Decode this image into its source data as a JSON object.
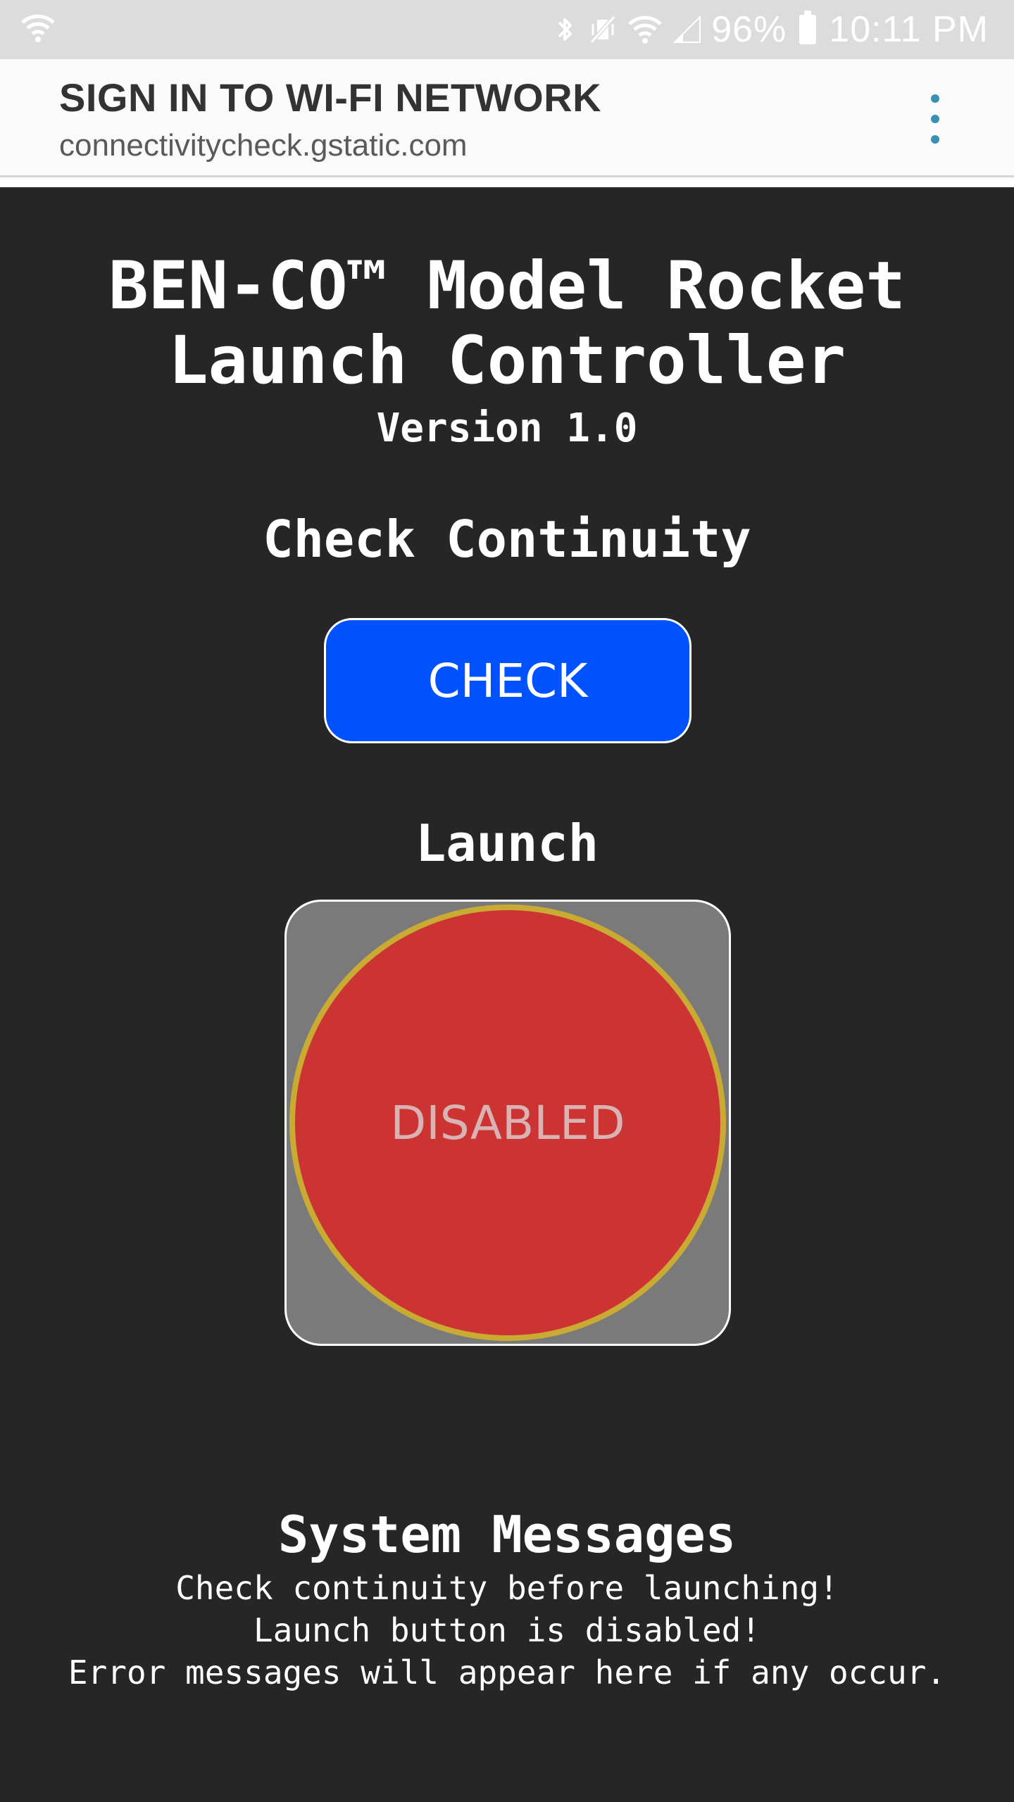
{
  "status_bar": {
    "battery": "96%",
    "time": "10:11 PM"
  },
  "portal": {
    "title": "SIGN IN TO WI-FI NETWORK",
    "url": "connectivitycheck.gstatic.com"
  },
  "app": {
    "title_line1": "BEN-CO™ Model Rocket",
    "title_line2": "Launch Controller",
    "version": "Version 1.0"
  },
  "continuity": {
    "heading": "Check Continuity",
    "button_label": "CHECK",
    "button_color": "#0052ff"
  },
  "launch": {
    "heading": "Launch",
    "button_label": "DISABLED",
    "button_color": "#cc3333",
    "ring_color": "#c9aa33"
  },
  "messages": {
    "heading": "System Messages",
    "lines": [
      "Check continuity before launching!",
      "Launch button is disabled!",
      "Error messages will appear here if any occur."
    ]
  }
}
